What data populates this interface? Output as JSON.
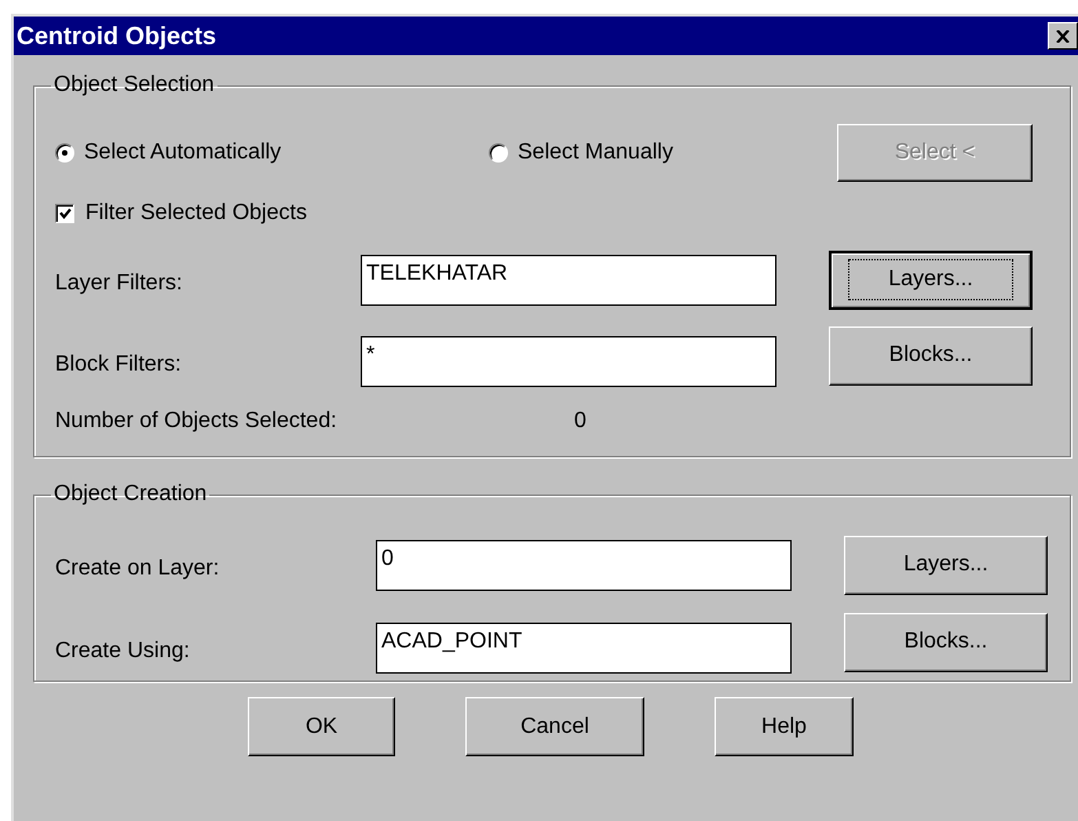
{
  "window": {
    "title": "Centroid Objects"
  },
  "object_selection": {
    "title": "Object Selection",
    "modes": [
      {
        "label": "Select Automatically",
        "selected": true
      },
      {
        "label": "Select Manually",
        "selected": false
      }
    ],
    "select_button": {
      "label": "Select <",
      "disabled": true
    },
    "filter": {
      "label": "Filter Selected Objects",
      "checked": true
    },
    "fields": [
      {
        "label": "Layer Filters:",
        "value": "TELEKHATAR",
        "button": {
          "label": "Layers...",
          "default": true
        }
      },
      {
        "label": "Block Filters:",
        "value": "*",
        "button": {
          "label": "Blocks...",
          "default": false
        }
      }
    ],
    "count": {
      "label": "Number of Objects Selected:",
      "value": "0"
    }
  },
  "object_creation": {
    "title": "Object Creation",
    "fields": [
      {
        "label": "Create on Layer:",
        "value": "0",
        "button": {
          "label": "Layers...",
          "default": false
        }
      },
      {
        "label": "Create Using:",
        "value": "ACAD_POINT",
        "button": {
          "label": "Blocks...",
          "default": false
        }
      }
    ]
  },
  "buttons": [
    {
      "label": "OK"
    },
    {
      "label": "Cancel"
    },
    {
      "label": "Help"
    }
  ]
}
